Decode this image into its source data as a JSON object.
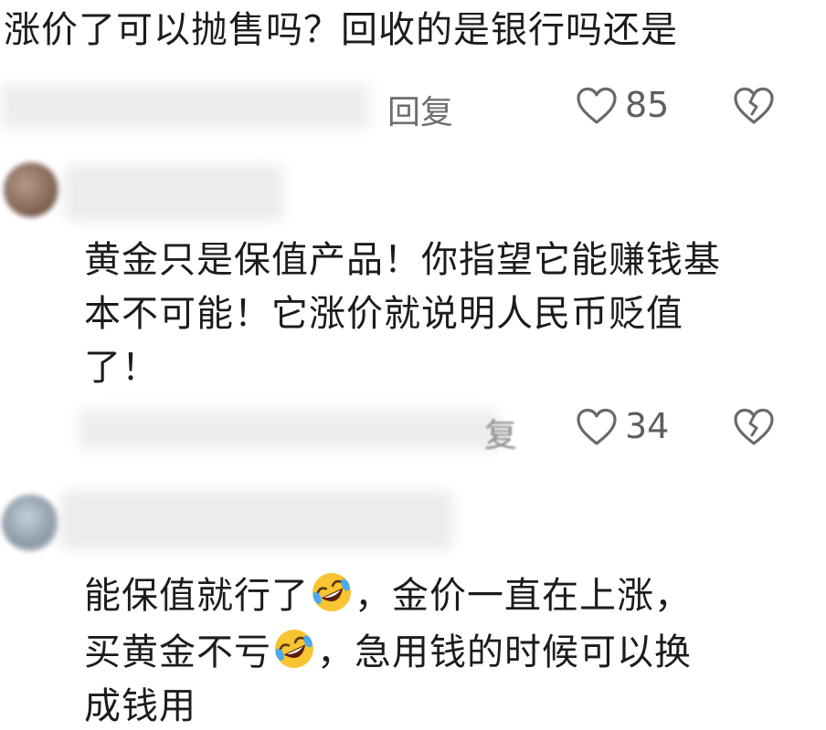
{
  "comments": [
    {
      "text_lines": [
        "涨价了可以抛售吗？回收的是银行吗还是"
      ],
      "reply_label": "回复",
      "like_count": "85"
    },
    {
      "text_lines": [
        "黄金只是保值产品！你指望它能赚钱基",
        "本不可能！它涨价就说明人民币贬值",
        "了！"
      ],
      "reply_label": "复",
      "like_count": "34"
    },
    {
      "text_segments": [
        {
          "before": "能保值就行了",
          "after": "，金价一直在上涨，"
        },
        {
          "before": "买黄金不亏",
          "after": "，急用钱的时候可以换"
        },
        {
          "before": "成钱用",
          "after": ""
        }
      ]
    }
  ],
  "icons": {
    "like": "heart-outline-icon",
    "dislike": "broken-heart-icon",
    "emoji": "rofl-emoji-icon"
  },
  "colors": {
    "text": "#1c1c1c",
    "meta": "#6e6e6e",
    "emoji_yellow": "#f9c431",
    "blur": "#efefef"
  }
}
